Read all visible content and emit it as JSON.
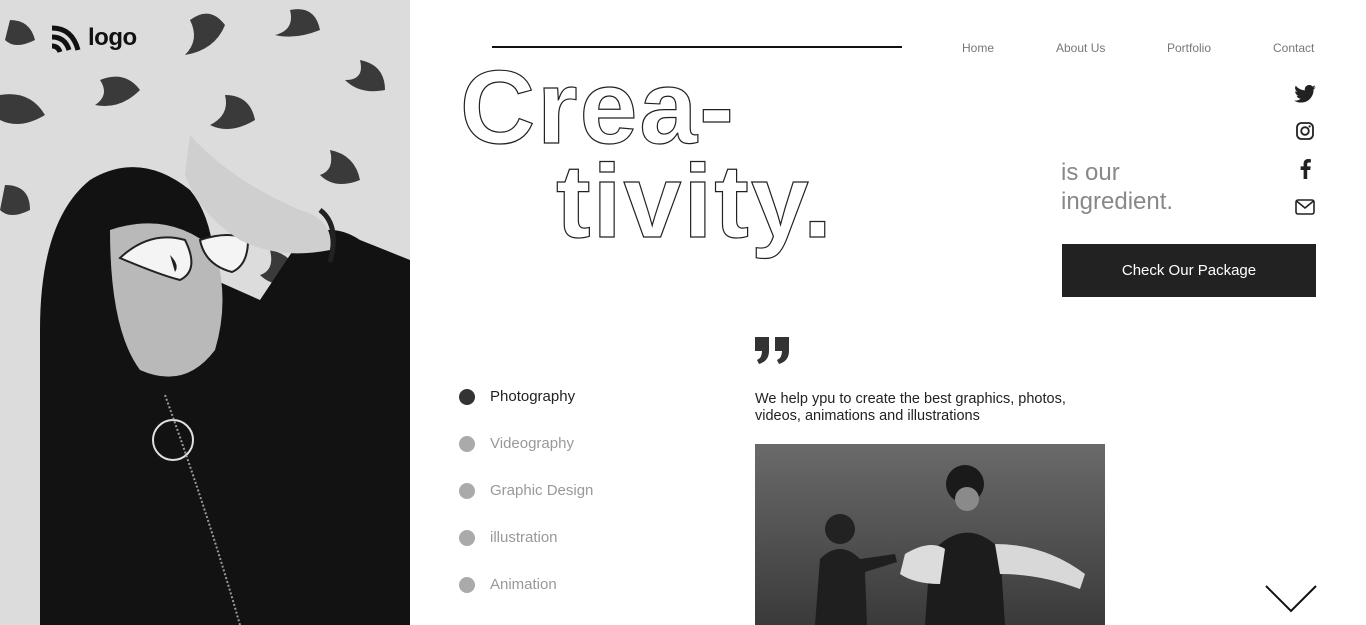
{
  "brand": {
    "logo_text": "logo"
  },
  "nav": {
    "items": [
      {
        "label": "Home"
      },
      {
        "label": "About Us"
      },
      {
        "label": "Portfolio"
      },
      {
        "label": "Contact"
      }
    ]
  },
  "hero": {
    "headline_line1": "Crea-",
    "headline_line2": "tivity.",
    "tagline_line1": "is our",
    "tagline_line2": "ingredient.",
    "cta_label": "Check Our Package"
  },
  "social": [
    "twitter-icon",
    "instagram-icon",
    "facebook-icon",
    "mail-icon"
  ],
  "services": [
    {
      "label": "Photography",
      "active": true
    },
    {
      "label": "Videography",
      "active": false
    },
    {
      "label": "Graphic Design",
      "active": false
    },
    {
      "label": "illustration",
      "active": false
    },
    {
      "label": "Animation",
      "active": false
    }
  ],
  "quote": {
    "text": "We help ypu to create the best graphics, photos, videos, animations and illustrations"
  },
  "colors": {
    "accent": "#222222",
    "muted": "#999999",
    "nav": "#777777"
  }
}
